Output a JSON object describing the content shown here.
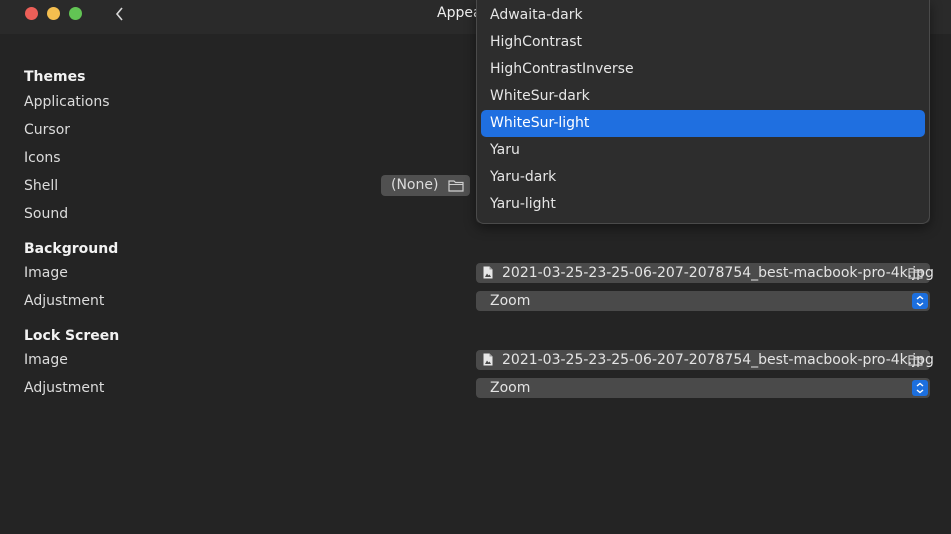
{
  "window": {
    "title": "Appearance"
  },
  "themes": {
    "heading": "Themes",
    "rows": [
      {
        "label": "Applications"
      },
      {
        "label": "Cursor"
      },
      {
        "label": "Icons"
      },
      {
        "label": "Shell",
        "value": "(None)"
      },
      {
        "label": "Sound"
      }
    ]
  },
  "background": {
    "heading": "Background",
    "image_label": "Image",
    "image_value": "2021-03-25-23-25-06-207-2078754_best-macbook-pro-4k.jpg",
    "adjustment_label": "Adjustment",
    "adjustment_value": "Zoom"
  },
  "lock_screen": {
    "heading": "Lock Screen",
    "image_label": "Image",
    "image_value": "2021-03-25-23-25-06-207-2078754_best-macbook-pro-4k.jpg",
    "adjustment_label": "Adjustment",
    "adjustment_value": "Zoom"
  },
  "dropdown": {
    "items": [
      "Adwaita-dark",
      "HighContrast",
      "HighContrastInverse",
      "WhiteSur-dark",
      "WhiteSur-light",
      "Yaru",
      "Yaru-dark",
      "Yaru-light"
    ],
    "selected": "WhiteSur-light"
  },
  "colors": {
    "accent": "#1f6fe0",
    "window_bg": "#242424",
    "close": "#ec5f58",
    "minimize": "#f4be4f",
    "maximize": "#62c454"
  }
}
